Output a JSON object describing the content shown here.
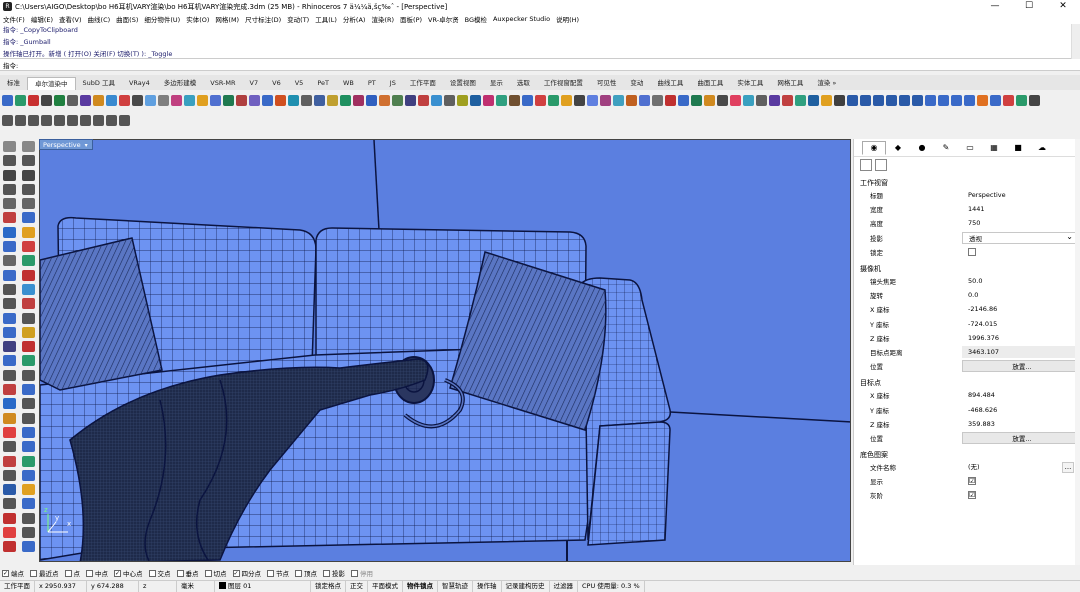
{
  "window": {
    "title": "C:\\Users\\AIGO\\Desktop\\bo H6耳机VARY渲染\\bo H6耳机VARY渲染完成.3dm (25 MB) - Rhinoceros 7 ä¼¼ä,šç‰ˆ - [Perspective]",
    "min_glyph": "—",
    "max_glyph": "☐",
    "close_glyph": "✕"
  },
  "menu": [
    "文件(F)",
    "编辑(E)",
    "查看(V)",
    "曲线(C)",
    "曲面(S)",
    "细分物件(U)",
    "实体(O)",
    "网格(M)",
    "尺寸标注(D)",
    "变动(T)",
    "工具(L)",
    "分析(A)",
    "渲染(R)",
    "面板(P)",
    "VR-卓尔贤",
    "BG模检",
    "Auxpecker Studio",
    "说明(H)"
  ],
  "command_history": [
    "指令: _CopyToClipboard",
    "指令: _Gumball",
    "操作轴已打开。新增 ( 打开(O) 关闭(F) 切换(T) ): _Toggle"
  ],
  "command_prompt": {
    "label": "指令:",
    "value": ""
  },
  "toolbar_tabs": [
    {
      "label": "标准",
      "active": false
    },
    {
      "label": "卓尔渲染中",
      "active": true
    },
    {
      "label": "SubD 工具",
      "active": false
    },
    {
      "label": "VRay4",
      "active": false
    },
    {
      "label": "多边形建模",
      "active": false
    },
    {
      "label": "VSR-MR",
      "active": false
    },
    {
      "label": "V7",
      "active": false
    },
    {
      "label": "V6",
      "active": false
    },
    {
      "label": "V5",
      "active": false
    },
    {
      "label": "PeT",
      "active": false
    },
    {
      "label": "WB",
      "active": false
    },
    {
      "label": "PT",
      "active": false
    },
    {
      "label": "JS",
      "active": false
    },
    {
      "label": "工作平面",
      "active": false
    },
    {
      "label": "设置视图",
      "active": false
    },
    {
      "label": "显示",
      "active": false
    },
    {
      "label": "选取",
      "active": false
    },
    {
      "label": "工作视窗配置",
      "active": false
    },
    {
      "label": "可见性",
      "active": false
    },
    {
      "label": "变动",
      "active": false
    },
    {
      "label": "曲线工具",
      "active": false
    },
    {
      "label": "曲面工具",
      "active": false
    },
    {
      "label": "实体工具",
      "active": false
    },
    {
      "label": "网格工具",
      "active": false
    },
    {
      "label": "渲染 »",
      "active": false
    }
  ],
  "toolbar_icon_colors": [
    "#3a6ac8",
    "#2a9a6a",
    "#c83030",
    "#444444",
    "#208040",
    "#606060",
    "#5a3aa0",
    "#d08a20",
    "#3a8ad0",
    "#d04040",
    "#4a4a4a",
    "#60a0e0",
    "#808080",
    "#c04080",
    "#3aa0c0",
    "#e0a020",
    "#5070d0",
    "#207a50",
    "#b04040",
    "#7060c0",
    "#3a6ac8",
    "#d05020",
    "#2090b0",
    "#606060",
    "#4060a0",
    "#c0a030",
    "#209060",
    "#a03060",
    "#3060c0",
    "#d07030",
    "#508050",
    "#404080",
    "#c04040",
    "#3a90d0",
    "#606060",
    "#a0a020",
    "#2060a0",
    "#c03070",
    "#30a080",
    "#705030",
    "#3a6ac8",
    "#d04040",
    "#2a9a6a",
    "#e0a020",
    "#444444",
    "#6080e0",
    "#a04080",
    "#40a0c0",
    "#c06020",
    "#5070d0",
    "#707070",
    "#c03030",
    "#3a6ac8",
    "#207a50",
    "#d08a20",
    "#4a4a4a",
    "#e04060",
    "#3aa0c0",
    "#606060",
    "#5a3aa0",
    "#c04040",
    "#30a080",
    "#2060a0",
    "#e0a020",
    "#404040",
    "#2a5aa8",
    "#2a5aa8",
    "#2a5aa8",
    "#2a5aa8",
    "#2a5aa8",
    "#2a5aa8",
    "#3a6ac8",
    "#3a6ac8",
    "#3a6ac8",
    "#3a6ac8",
    "#e07020",
    "#3a6ac8",
    "#d04040",
    "#2a9a6a",
    "#444444"
  ],
  "toolbar2_icon_colors": [
    "#555555",
    "#555555",
    "#555555",
    "#555555",
    "#555555",
    "#555555",
    "#555555",
    "#555555",
    "#555555",
    "#555555"
  ],
  "left_tool_icon_colors": [
    "#888888",
    "#888888",
    "#555555",
    "#555555",
    "#444444",
    "#444444",
    "#555555",
    "#555555",
    "#666666",
    "#666666",
    "#c04040",
    "#3a6ac8",
    "#2a6ac8",
    "#e0a020",
    "#3a6ac8",
    "#d04040",
    "#666666",
    "#2a9a6a",
    "#3a6ac8",
    "#c03030",
    "#555555",
    "#3a90d0",
    "#555555",
    "#c04040",
    "#3a6ac8",
    "#555555",
    "#3a6ac8",
    "#d0a020",
    "#404080",
    "#c03030",
    "#3a6ac8",
    "#2a9a6a",
    "#555555",
    "#555555",
    "#c04040",
    "#3a6ac8",
    "#2a6ac8",
    "#555555",
    "#d08a20",
    "#555555",
    "#e04040",
    "#3a6ac8",
    "#555555",
    "#3a6ac8",
    "#c04040",
    "#2a9a6a",
    "#555555",
    "#3a6ac8",
    "#2a5aa8",
    "#e0a020",
    "#555555",
    "#3a6ac8",
    "#c03030",
    "#555555",
    "#e04040",
    "#555555",
    "#c03030",
    "#3a6ac8"
  ],
  "viewport": {
    "label": "Perspective",
    "dropdown": "▾",
    "colors": {
      "background": "#5b7fe0",
      "sofa": "#6d93f2",
      "wire": "#0b1440",
      "cloth": "#1e2a4a",
      "pillow": "#5a76c4"
    }
  },
  "properties_panel": {
    "tab_icons": [
      "properties-icon",
      "material-icon",
      "environment-icon",
      "light-icon",
      "layer-icon",
      "named-view-icon",
      "display-icon",
      "help-icon"
    ],
    "viewport_section": "工作视窗",
    "viewport_rows": [
      {
        "k": "标题",
        "v": "Perspective"
      },
      {
        "k": "宽度",
        "v": "1441"
      },
      {
        "k": "高度",
        "v": "750"
      },
      {
        "k": "投影",
        "v": "透视"
      },
      {
        "k": "锁定",
        "v": ""
      }
    ],
    "camera_section": "摄像机",
    "camera_rows": [
      {
        "k": "镜头焦距",
        "v": "50.0"
      },
      {
        "k": "旋转",
        "v": "0.0"
      },
      {
        "k": "X 座标",
        "v": "-2146.86"
      },
      {
        "k": "Y 座标",
        "v": "-724.015"
      },
      {
        "k": "Z 座标",
        "v": "1996.376"
      },
      {
        "k": "目标点距离",
        "v": "3463.107"
      },
      {
        "k": "位置",
        "v": "放置..."
      }
    ],
    "target_section": "目标点",
    "target_rows": [
      {
        "k": "X 座标",
        "v": "894.484"
      },
      {
        "k": "Y 座标",
        "v": "-468.626"
      },
      {
        "k": "Z 座标",
        "v": "359.883"
      },
      {
        "k": "位置",
        "v": "放置..."
      }
    ],
    "wallpaper_section": "底色图案",
    "wallpaper_rows": [
      {
        "k": "文件名称",
        "v": "(无)"
      },
      {
        "k": "显示",
        "v": "☑"
      },
      {
        "k": "灰阶",
        "v": "☑"
      }
    ],
    "ellipsis": "..."
  },
  "osnaps": [
    {
      "label": "端点",
      "checked": true
    },
    {
      "label": "最近点",
      "checked": false
    },
    {
      "label": "点",
      "checked": false
    },
    {
      "label": "中点",
      "checked": false
    },
    {
      "label": "中心点",
      "checked": true
    },
    {
      "label": "交点",
      "checked": false
    },
    {
      "label": "垂点",
      "checked": false
    },
    {
      "label": "切点",
      "checked": false
    },
    {
      "label": "四分点",
      "checked": true
    },
    {
      "label": "节点",
      "checked": false
    },
    {
      "label": "顶点",
      "checked": false
    },
    {
      "label": "投影",
      "checked": false
    },
    {
      "label": "停用",
      "checked": false
    }
  ],
  "status": {
    "cplane": "工作平面",
    "x": "x 2950.937",
    "y": "y 674.288",
    "z": "z",
    "units": "毫米",
    "layer": "图层 01",
    "grid_snap": "锁定格点",
    "ortho": "正交",
    "planar": "平面模式",
    "osnap": "物件锁点",
    "smarttrack": "智慧轨迹",
    "gumball": "操作轴",
    "history": "记录建构历史",
    "filter": "过滤器",
    "cpu": "CPU 使用量: 0.3 %"
  }
}
